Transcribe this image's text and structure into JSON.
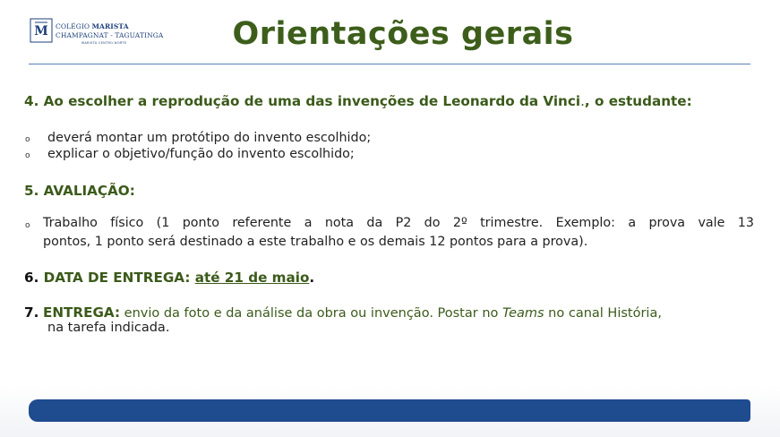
{
  "logo": {
    "line1_prefix": "COLÉGIO ",
    "line1_bold": "MARISTA",
    "line2": "CHAMPAGNAT - TAGUATINGA",
    "line3": "MARISTA CENTRO-NORTE"
  },
  "title": "Orientações gerais",
  "section4": {
    "number": "4.",
    "text": "Ao escolher a reprodução de uma das invenções de Leonardo da Vinci",
    "dot": ".",
    "tail": ", o estudante:"
  },
  "bullets4": [
    "deverá montar um protótipo do invento escolhido;",
    "explicar o objetivo/função do invento escolhido;"
  ],
  "bullet_symbol": "o",
  "section5": {
    "heading": "5. AVALIAÇÃO:",
    "line1": "Trabalho físico (1 ponto referente a nota da P2 do 2º trimestre. Exemplo: a prova vale 13",
    "line2": "pontos, 1 ponto será destinado a este trabalho e os demais 12 pontos para a prova)."
  },
  "section6": {
    "number": "6.",
    "label": "DATA DE ENTREGA:",
    "date": "até 21 de maio",
    "end": "."
  },
  "section7": {
    "number": "7.",
    "label": "ENTREGA:",
    "text_before": " envio da foto e da análise da obra ou invenção. Postar no ",
    "italic": "Teams",
    "text_after": " no canal História,",
    "line2": "na tarefa indicada."
  },
  "colors": {
    "title_green": "#3d5e1b",
    "brand_blue": "#1f4b8f"
  }
}
